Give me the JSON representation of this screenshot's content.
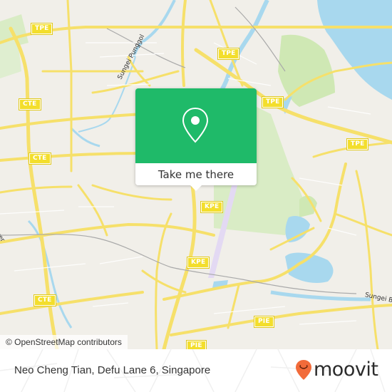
{
  "map": {
    "colors": {
      "land": "#f1efe9",
      "water": "#a8d8ee",
      "park": "#cfe8b4",
      "road": "#f6e06a",
      "runway": "#e3d9f3"
    },
    "shields": [
      {
        "label": "TPE"
      },
      {
        "label": "TPE"
      },
      {
        "label": "TPE"
      },
      {
        "label": "TPE"
      },
      {
        "label": "CTE"
      },
      {
        "label": "CTE"
      },
      {
        "label": "CTE"
      },
      {
        "label": "KPE"
      },
      {
        "label": "KPE"
      },
      {
        "label": "PIE"
      },
      {
        "label": "PIE"
      }
    ],
    "road_labels": [
      {
        "text": "Sungei Punggol"
      },
      {
        "text": "Sungei Bedok"
      },
      {
        "text": "Kallang River"
      }
    ],
    "attribution": "© OpenStreetMap contributors"
  },
  "popup": {
    "icon": "map-pin-icon",
    "button_label": "Take me there",
    "accent": "#1fba69"
  },
  "footer": {
    "place_name": "Neo Cheng Tian, Defu Lane 6, Singapore",
    "brand": "moovit",
    "brand_color": "#f26b3a"
  }
}
